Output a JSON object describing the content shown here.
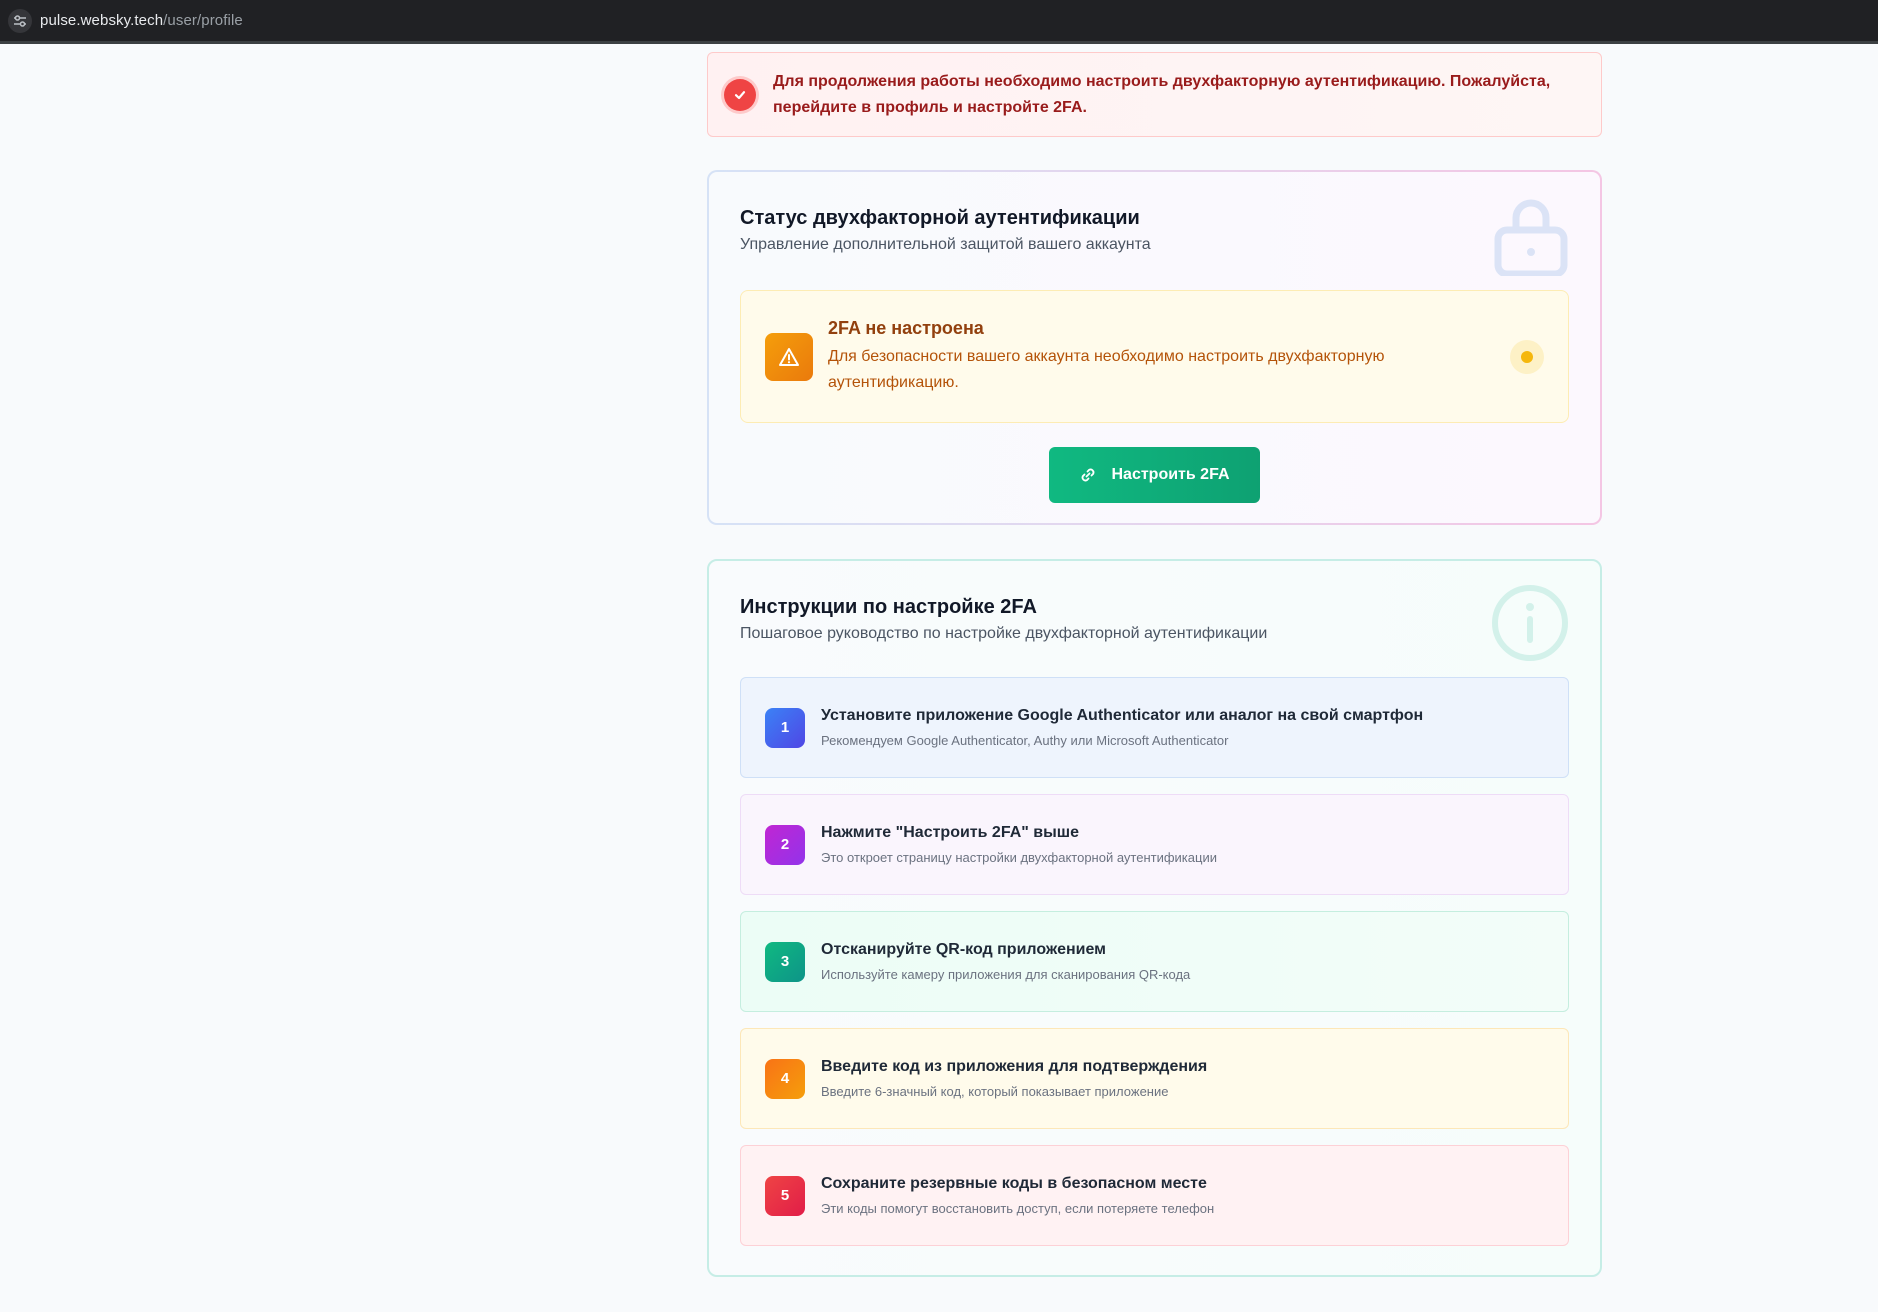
{
  "browser": {
    "url_host": "pulse.websky.tech",
    "url_path": "/user/profile",
    "site_info_icon": "tune-icon"
  },
  "alert": {
    "icon": "check-circle-icon",
    "line1": "Для продолжения работы необходимо настроить двухфакторную аутентификацию. Пожалуйста,",
    "line2": "перейдите в профиль и настройте 2FA.",
    "color": "#991b1b"
  },
  "status_card": {
    "title": "Статус двухфакторной аутентификации",
    "subtitle": "Управление дополнительной защитой вашего аккаунта",
    "decor_icon": "lock-icon",
    "warning": {
      "icon": "warning-triangle-icon",
      "title": "2FA не настроена",
      "line1": "Для безопасности вашего аккаунта необходимо настроить двухфакторную",
      "line2": "аутентификацию.",
      "indicator_color": "#f5b70c"
    },
    "setup_button": {
      "icon": "link-icon",
      "label": "Настроить 2FA",
      "color": "#10b981"
    }
  },
  "instructions_card": {
    "title": "Инструкции по настройке 2FA",
    "subtitle": "Пошаговое руководство по настройке двухфакторной аутентификации",
    "decor_icon": "info-icon",
    "steps": [
      {
        "number": "1",
        "title": "Установите приложение Google Authenticator или аналог на свой смартфон",
        "description": "Рекомендуем Google Authenticator, Authy или Microsoft Authenticator"
      },
      {
        "number": "2",
        "title": "Нажмите \"Настроить 2FA\" выше",
        "description": "Это откроет страницу настройки двухфакторной аутентификации"
      },
      {
        "number": "3",
        "title": "Отсканируйте QR-код приложением",
        "description": "Используйте камеру приложения для сканирования QR-кода"
      },
      {
        "number": "4",
        "title": "Введите код из приложения для подтверждения",
        "description": "Введите 6-значный код, который показывает приложение"
      },
      {
        "number": "5",
        "title": "Сохраните резервные коды в безопасном месте",
        "description": "Эти коды помогут восстановить доступ, если потеряете телефон"
      }
    ]
  }
}
